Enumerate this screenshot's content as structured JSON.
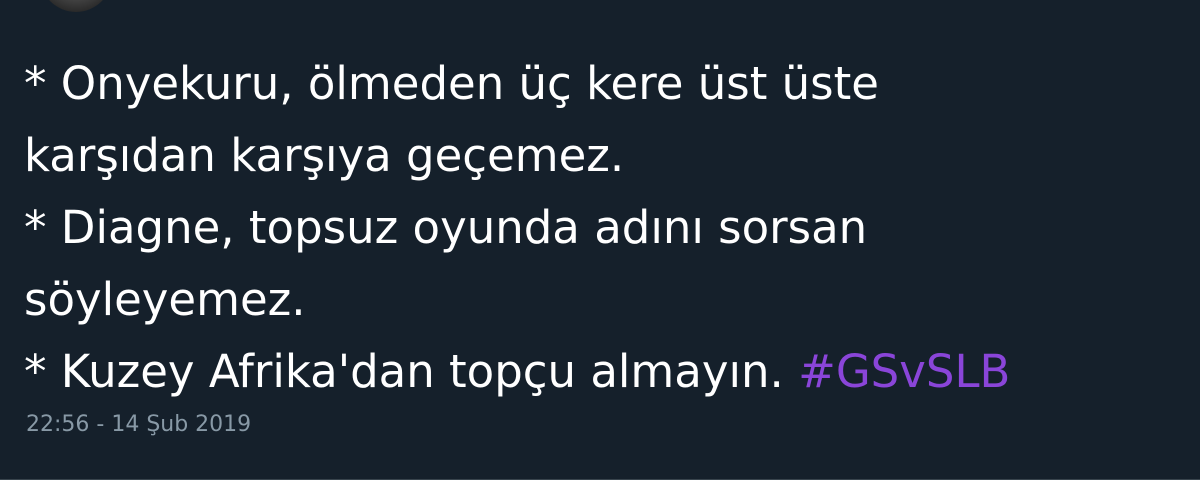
{
  "tweet": {
    "lines": [
      "* Onyekuru, ölmeden üç kere üst üste",
      "karşıdan karşıya geçemez.",
      "* Diagne, topsuz oyunda adını sorsan",
      "söyleyemez.",
      "* Kuzey Afrika'dan topçu almayın."
    ],
    "hashtag": "#GSvSLB",
    "timestamp": "22:56 - 14 Şub 2019"
  },
  "colors": {
    "background": "#15202b",
    "text": "#ffffff",
    "hashtag": "#8a45d9",
    "timestamp": "#8899a6"
  }
}
